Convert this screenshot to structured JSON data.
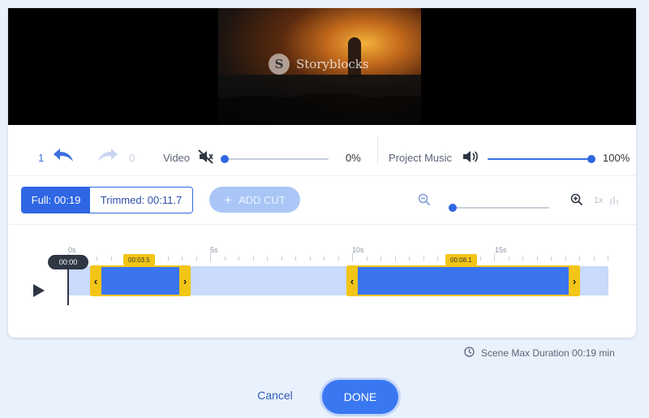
{
  "preview": {
    "watermark_text": "Storyblocks",
    "watermark_logo": "S"
  },
  "controls": {
    "undo_count": "1",
    "redo_count": "0",
    "video_label": "Video",
    "video_volume_text": "0%",
    "video_volume": 0,
    "music_label": "Project Music",
    "music_volume_text": "100%",
    "music_volume": 100
  },
  "trim_bar": {
    "full_label": "Full: 00:19",
    "trimmed_label": "Trimmed: 00:11.7",
    "add_cut_label": "ADD CUT",
    "zoom_level": "1x"
  },
  "timeline": {
    "ruler_labels": [
      "0s",
      "5s",
      "10s",
      "15s"
    ],
    "playhead_time": "00:00",
    "clips": [
      {
        "start_tag": "00:03.5"
      },
      {
        "start_tag": "00:08.1"
      }
    ]
  },
  "footer": {
    "max_duration_text": "Scene Max Duration 00:19 min",
    "cancel_label": "Cancel",
    "done_label": "DONE"
  },
  "colors": {
    "accent": "#2f66e3",
    "clip_handle": "#f2c516",
    "background": "#e9f1fc"
  }
}
